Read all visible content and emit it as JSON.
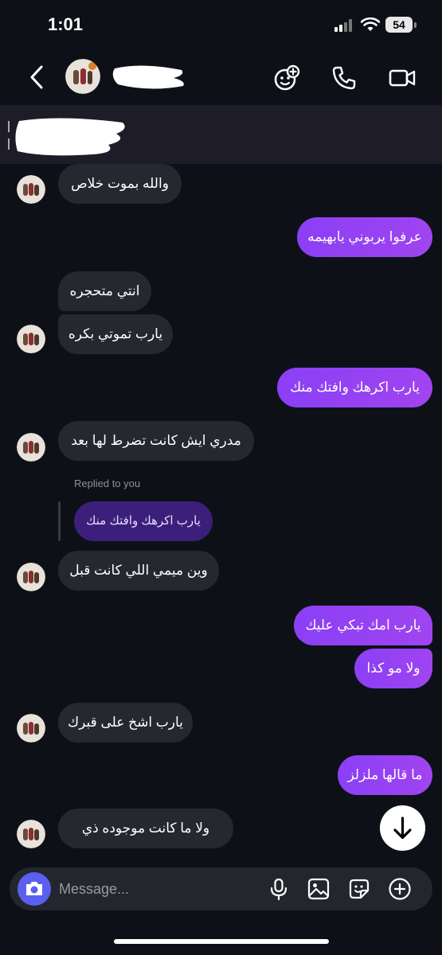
{
  "status_bar": {
    "time": "1:01",
    "battery": "54"
  },
  "header": {
    "back_icon": "chevron-left-icon",
    "contact_name": "",
    "actions": [
      "group-add-icon",
      "phone-icon",
      "video-camera-icon"
    ]
  },
  "pinned": {
    "text": ""
  },
  "messages": [
    {
      "dir": "in",
      "text": "والله بموت خلاص"
    },
    {
      "dir": "out",
      "text": "عرفوا يربوني يابهيمه"
    },
    {
      "dir": "in",
      "text": "انتي متحجره"
    },
    {
      "dir": "in",
      "text": "يارب تموتي بكره"
    },
    {
      "dir": "out",
      "text": "يارب اكرهك وافتك منك"
    },
    {
      "dir": "in",
      "text": "مدري ايش كانت تضرط لها بعد"
    },
    {
      "dir": "in",
      "text": "وين ميمي اللي كانت قبل",
      "reply_label": "Replied to you",
      "reply_text": "يارب اكرهك وافتك منك"
    },
    {
      "dir": "out",
      "text": "يارب امك تبكي عليك"
    },
    {
      "dir": "out",
      "text": "ولا مو كذا"
    },
    {
      "dir": "in",
      "text": "يارب اشخ على قبرك"
    },
    {
      "dir": "out",
      "text": "ما قالها ملزلز"
    },
    {
      "dir": "in",
      "text": "ولا ما كانت موجوده ذي"
    }
  ],
  "composer": {
    "placeholder": "Message...",
    "icons": [
      "camera-icon",
      "microphone-icon",
      "gallery-icon",
      "sticker-icon",
      "plus-icon"
    ]
  },
  "scroll_down_icon": "arrow-down-icon",
  "colors": {
    "background": "#0d1117",
    "incoming": "#262830",
    "outgoing": "#9841f2",
    "reply_quote": "#3b1f7a",
    "camera": "#5b5ff0"
  }
}
